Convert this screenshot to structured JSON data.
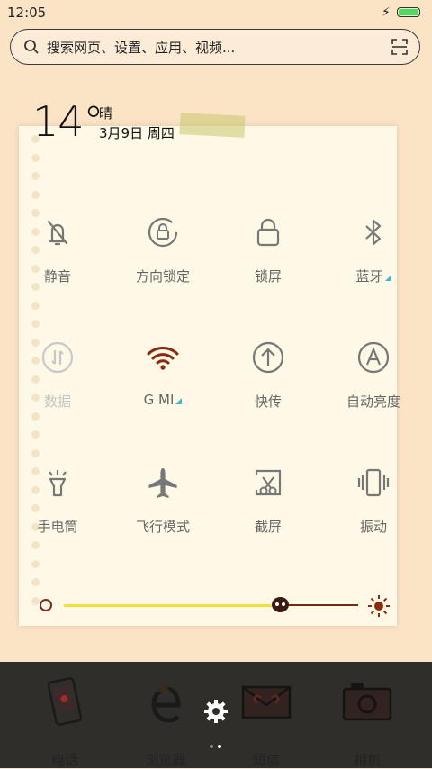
{
  "status": {
    "time": "12:05",
    "charge_icon": "charging-bolt-icon",
    "battery_level": 1.0
  },
  "search": {
    "placeholder": "搜索网页、设置、应用、视频...",
    "search_icon": "search-icon",
    "scan_icon": "scan-icon"
  },
  "weather": {
    "temp": "14°",
    "condition": "晴",
    "date": "3月9日 周四"
  },
  "toggles": [
    {
      "label": "静音",
      "icon": "bell-off-icon",
      "active": false
    },
    {
      "label": "方向锁定",
      "icon": "rotation-lock-icon",
      "active": false
    },
    {
      "label": "锁屏",
      "icon": "lock-icon",
      "active": false
    },
    {
      "label": "蓝牙",
      "icon": "bluetooth-icon",
      "active": false,
      "has_menu": true
    },
    {
      "label": "数据",
      "icon": "mobile-data-icon",
      "active": false,
      "disabled": true
    },
    {
      "label": "G    MI",
      "icon": "wifi-icon",
      "active": true,
      "has_menu": true
    },
    {
      "label": "快传",
      "icon": "quick-transfer-icon",
      "active": false
    },
    {
      "label": "自动亮度",
      "icon": "auto-brightness-icon",
      "active": false
    },
    {
      "label": "手电筒",
      "icon": "flashlight-icon",
      "active": false
    },
    {
      "label": "飞行模式",
      "icon": "airplane-icon",
      "active": false
    },
    {
      "label": "截屏",
      "icon": "screenshot-icon",
      "active": false
    },
    {
      "label": "振动",
      "icon": "vibrate-icon",
      "active": false
    }
  ],
  "brightness": {
    "level": 0.73
  },
  "dock": [
    {
      "label": "电话",
      "icon": "phone-app-icon"
    },
    {
      "label": "浏览器",
      "icon": "browser-app-icon"
    },
    {
      "label": "短信",
      "icon": "messages-app-icon"
    },
    {
      "label": "相机",
      "icon": "camera-app-icon"
    }
  ],
  "colors": {
    "wifi_active": "#8a2a10",
    "dock_bg": "#2f2e2b",
    "paper": "#fdf9e6",
    "accent_tri": "#4ab3c9"
  }
}
